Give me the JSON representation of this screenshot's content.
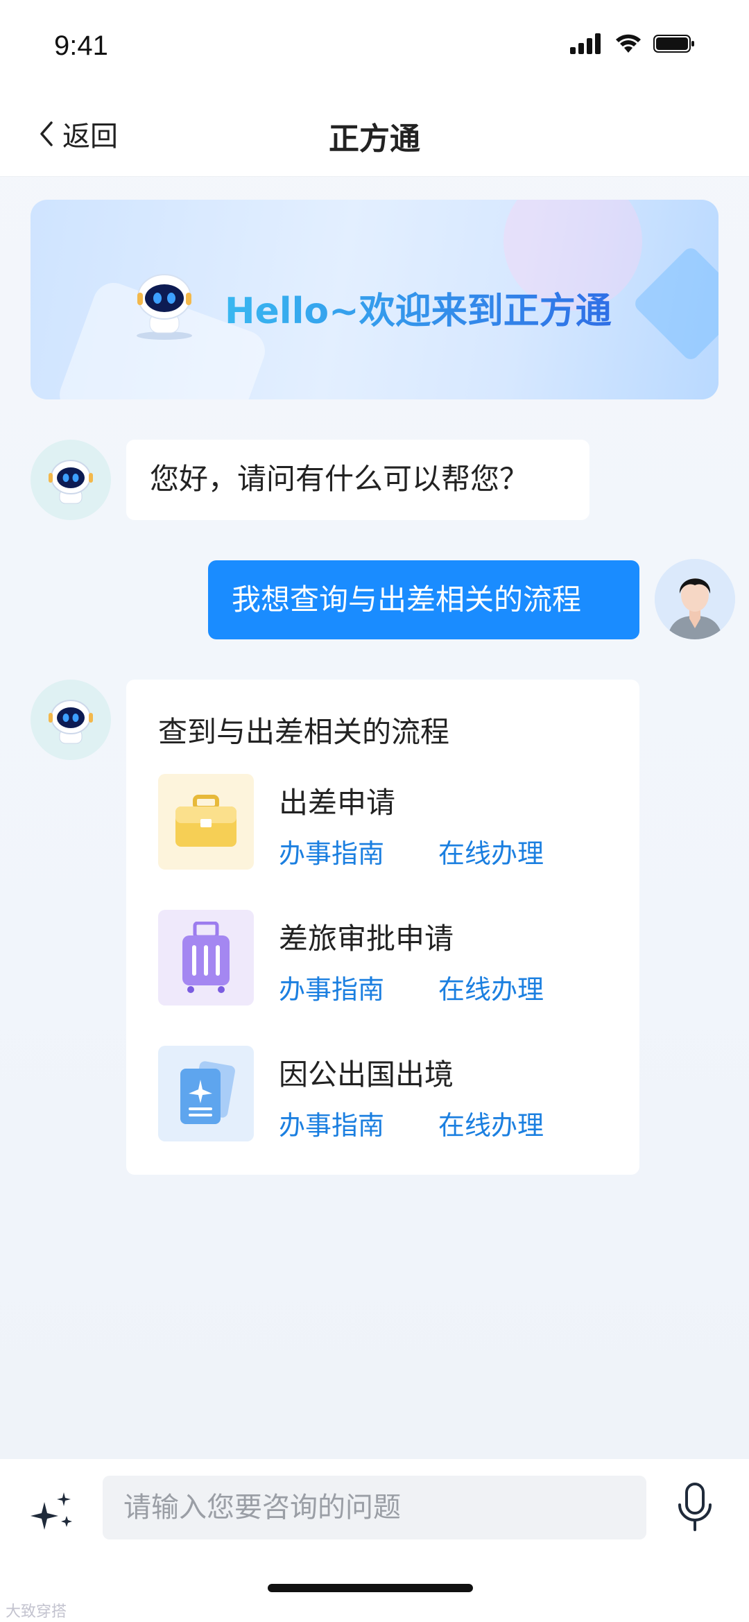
{
  "status_bar": {
    "time": "9:41"
  },
  "nav": {
    "back_label": "返回",
    "title": "正方通"
  },
  "banner": {
    "welcome": "Hello~欢迎来到正方通"
  },
  "chat": {
    "bot_greeting": "您好，请问有什么可以帮您？",
    "user_message": "我想查询与出差相关的流程",
    "result": {
      "title": "查到与出差相关的流程",
      "items": [
        {
          "name": "出差申请",
          "guide": "办事指南",
          "online": "在线办理",
          "icon": "briefcase-icon",
          "bg": "#fdf4dc"
        },
        {
          "name": "差旅审批申请",
          "guide": "办事指南",
          "online": "在线办理",
          "icon": "luggage-icon",
          "bg": "#efe9fb"
        },
        {
          "name": "因公出国出境",
          "guide": "办事指南",
          "online": "在线办理",
          "icon": "passport-icon",
          "bg": "#e4effc"
        }
      ]
    }
  },
  "input": {
    "placeholder": "请输入您要咨询的问题"
  },
  "watermark": "大致穿搭",
  "colors": {
    "accent": "#1a8cff",
    "link": "#1b7fe0"
  }
}
